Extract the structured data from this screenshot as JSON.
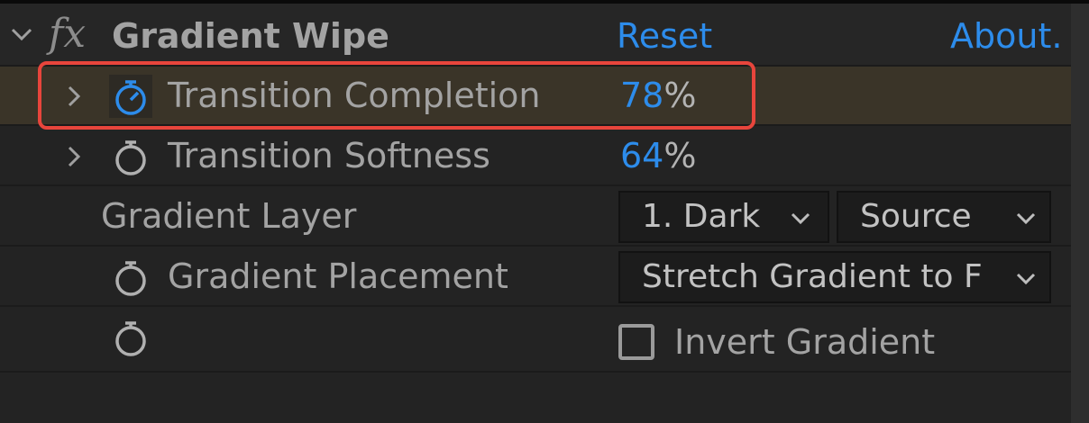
{
  "effect": {
    "name": "Gradient Wipe",
    "fx_symbol": "fx",
    "reset_label": "Reset",
    "about_label": "About."
  },
  "properties": {
    "transition_completion": {
      "label": "Transition Completion",
      "value": "78",
      "unit": "%"
    },
    "transition_softness": {
      "label": "Transition Softness",
      "value": "64",
      "unit": "%"
    },
    "gradient_layer": {
      "label": "Gradient Layer",
      "layer_value": "1. Dark",
      "source_value": "Source"
    },
    "gradient_placement": {
      "label": "Gradient Placement",
      "value": "Stretch Gradient to Fit"
    },
    "invert_gradient": {
      "label": "Invert Gradient",
      "checked": false
    }
  },
  "colors": {
    "accent_blue": "#2d8ceb",
    "highlight_red": "#e8453c",
    "panel_bg": "#232323",
    "selected_row_bg": "#3a3428"
  },
  "icons": {
    "expand": "chevron-down-icon",
    "collapse": "chevron-right-icon",
    "keyframe": "stopwatch-icon",
    "dropdown": "chevron-down-icon",
    "checkbox": "checkbox-icon"
  }
}
